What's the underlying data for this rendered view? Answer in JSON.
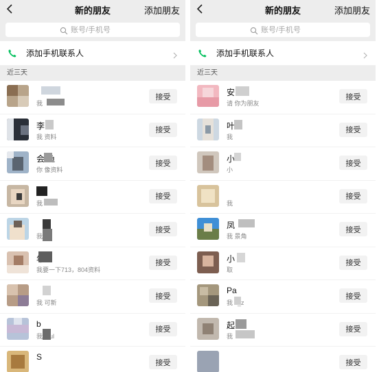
{
  "left": {
    "header": {
      "title": "新的朋友",
      "action": "添加朋友"
    },
    "search": {
      "placeholder": "账号/手机号"
    },
    "add_phone": {
      "label": "添加手机联系人"
    },
    "section": {
      "label": "近三天"
    },
    "rows": [
      {
        "name": "",
        "message": "我"
      },
      {
        "name": "李",
        "message": "我   资料"
      },
      {
        "name": "会   鱼",
        "message": "你   像资料"
      },
      {
        "name": "",
        "message": "我   -"
      },
      {
        "name": "",
        "message": "我   留"
      },
      {
        "name": "   年",
        "message": "我要一下713，804资料"
      },
      {
        "name": "",
        "message": "我   可新"
      },
      {
        "name": "b",
        "message": "我   aful"
      },
      {
        "name": "S",
        "message": ""
      }
    ],
    "accept_label": "接受"
  },
  "right": {
    "header": {
      "title": "新的朋友",
      "action": "添加朋友"
    },
    "search": {
      "placeholder": "账号/手机号"
    },
    "add_phone": {
      "label": "添加手机联系人"
    },
    "section": {
      "label": "近三天"
    },
    "rows": [
      {
        "name": "安",
        "message": "请   你为朋友"
      },
      {
        "name": "叶",
        "message": "我"
      },
      {
        "name": "小",
        "message": "小"
      },
      {
        "name": "",
        "message": "我"
      },
      {
        "name": "凤",
        "message": "我   景角"
      },
      {
        "name": "小",
        "message": "取"
      },
      {
        "name": "Pa",
        "message": "我   s_z"
      },
      {
        "name": "起",
        "message": "我"
      },
      {
        "name": "",
        "message": ""
      }
    ],
    "accept_label": "接受"
  },
  "colors": {
    "wechat_green": "#07c160",
    "header_bg": "#ededed",
    "button_bg": "#f2f2f2"
  },
  "icons": {
    "back": "chevron-left-icon",
    "search": "search-icon",
    "phone": "phone-icon",
    "more": "chevron-right-icon"
  }
}
